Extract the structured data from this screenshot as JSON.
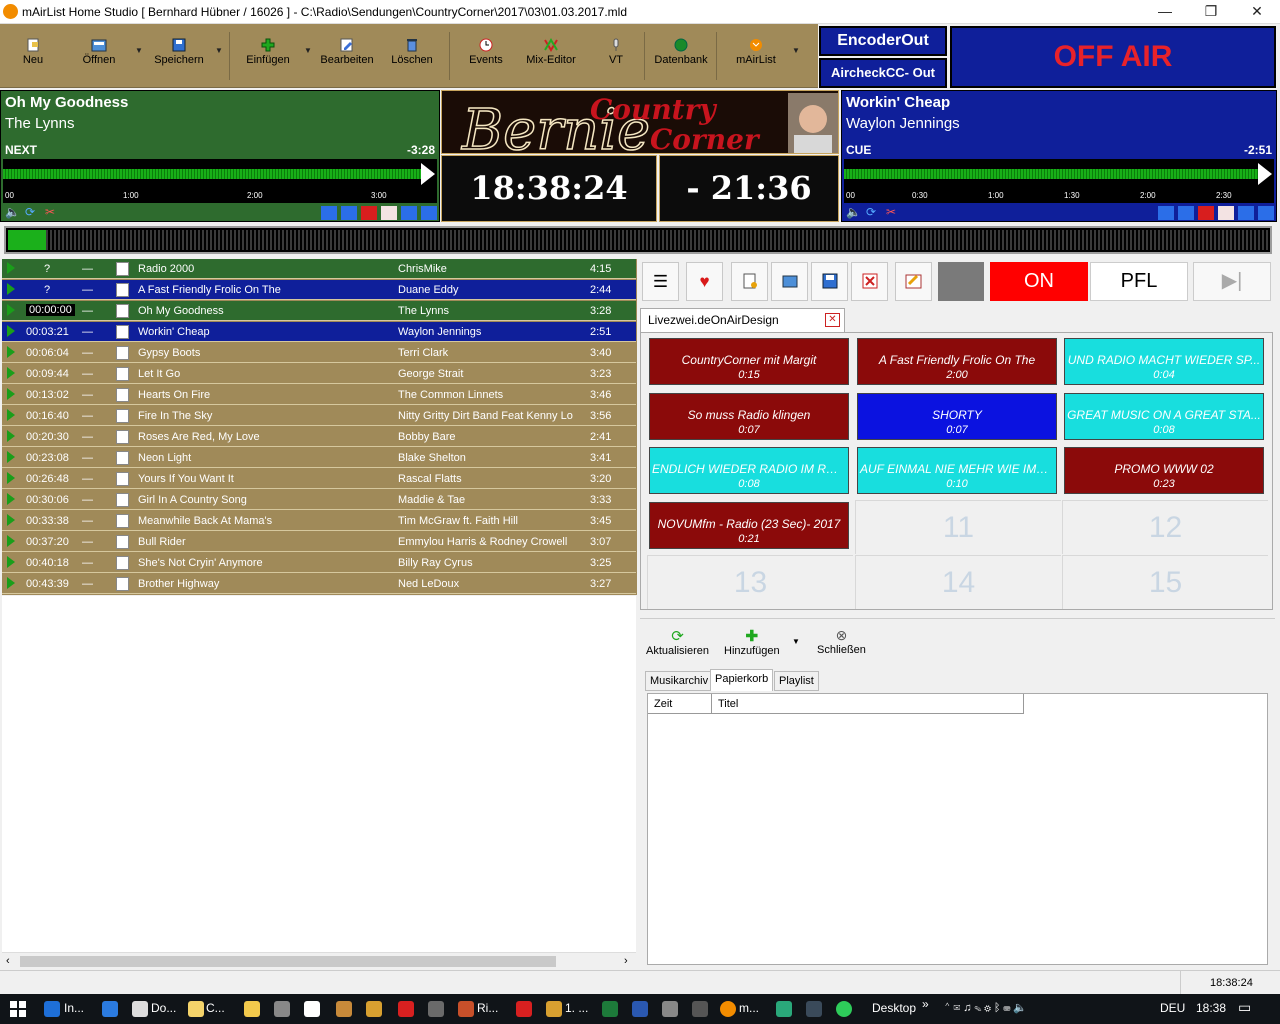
{
  "window": {
    "title": "mAirList Home Studio [ Bernhard Hübner / 16026 ] - C:\\Radio\\Sendungen\\CountryCorner\\2017\\03\\01.03.2017.mld",
    "min": "—",
    "max": "❐",
    "close": "✕"
  },
  "toolbar": {
    "buttons": [
      {
        "label": "Neu",
        "icon": "new-file-icon"
      },
      {
        "label": "Öffnen",
        "icon": "open-folder-icon"
      },
      {
        "label": "Speichern",
        "icon": "save-icon"
      },
      {
        "label": "Einfügen",
        "icon": "plus-icon"
      },
      {
        "label": "Bearbeiten",
        "icon": "edit-icon"
      },
      {
        "label": "Löschen",
        "icon": "delete-icon"
      },
      {
        "label": "Events",
        "icon": "clock-icon"
      },
      {
        "label": "Mix-Editor",
        "icon": "mixer-icon"
      },
      {
        "label": "VT",
        "icon": "microphone-icon"
      },
      {
        "label": "Datenbank",
        "icon": "database-icon"
      },
      {
        "label": "mAirList",
        "icon": "mairlist-logo-icon"
      }
    ]
  },
  "encoder": {
    "out": "EncoderOut",
    "aircheck": "AircheckCC- Out"
  },
  "air_status": "OFF AIR",
  "player_left": {
    "title": "Oh My Goodness",
    "artist": "The Lynns",
    "state": "NEXT",
    "remaining": "-3:28",
    "ruler": [
      "00",
      "1:00",
      "2:00",
      "3:00"
    ],
    "color": "#2e6b2e"
  },
  "player_right": {
    "title": "Workin' Cheap",
    "artist": "Waylon Jennings",
    "state": "CUE",
    "remaining": "-2:51",
    "ruler": [
      "00",
      "0:30",
      "1:00",
      "1:30",
      "2:00",
      "2:30"
    ],
    "color": "#0f1f9a"
  },
  "logo": {
    "line1": "Country",
    "line2": "Bernie",
    "line3": "Corner"
  },
  "clock": {
    "time": "18:38:24",
    "countdown": "- 21:36"
  },
  "playlist": {
    "rows": [
      {
        "time": "?",
        "title": "Radio 2000",
        "artist": "ChrisMike",
        "duration": "4:15",
        "bg": "#2e6b2e"
      },
      {
        "time": "?",
        "title": "A Fast Friendly Frolic On The",
        "artist": "Duane Eddy",
        "duration": "2:44",
        "bg": "#0f1f9a"
      },
      {
        "time": "00:00:00",
        "title": "Oh My Goodness",
        "artist": "The Lynns",
        "duration": "3:28",
        "bg": "#2e6b2e"
      },
      {
        "time": "00:03:21",
        "title": "Workin' Cheap",
        "artist": "Waylon Jennings",
        "duration": "2:51",
        "bg": "#0f1f9a"
      },
      {
        "time": "00:06:04",
        "title": "Gypsy Boots",
        "artist": "Terri Clark",
        "duration": "3:40",
        "bg": "#a08a59"
      },
      {
        "time": "00:09:44",
        "title": "Let It Go",
        "artist": "George Strait",
        "duration": "3:23",
        "bg": "#a08a59"
      },
      {
        "time": "00:13:02",
        "title": "Hearts On Fire",
        "artist": "The Common Linnets",
        "duration": "3:46",
        "bg": "#a08a59"
      },
      {
        "time": "00:16:40",
        "title": "Fire In The Sky",
        "artist": "Nitty Gritty Dirt Band Feat Kenny Lo",
        "duration": "3:56",
        "bg": "#a08a59"
      },
      {
        "time": "00:20:30",
        "title": "Roses Are Red, My Love",
        "artist": "Bobby Bare",
        "duration": "2:41",
        "bg": "#a08a59"
      },
      {
        "time": "00:23:08",
        "title": "Neon Light",
        "artist": "Blake Shelton",
        "duration": "3:41",
        "bg": "#a08a59"
      },
      {
        "time": "00:26:48",
        "title": "Yours If You Want It",
        "artist": "Rascal Flatts",
        "duration": "3:20",
        "bg": "#a08a59"
      },
      {
        "time": "00:30:06",
        "title": "Girl In A Country Song",
        "artist": "Maddie & Tae",
        "duration": "3:33",
        "bg": "#a08a59"
      },
      {
        "time": "00:33:38",
        "title": "Meanwhile Back At Mama's",
        "artist": "Tim McGraw  ft. Faith Hill",
        "duration": "3:45",
        "bg": "#a08a59"
      },
      {
        "time": "00:37:20",
        "title": "Bull Rider",
        "artist": "Emmylou Harris & Rodney Crowell",
        "duration": "3:07",
        "bg": "#a08a59"
      },
      {
        "time": "00:40:18",
        "title": "She's Not Cryin' Anymore",
        "artist": "Billy Ray Cyrus",
        "duration": "3:25",
        "bg": "#a08a59"
      },
      {
        "time": "00:43:39",
        "title": "Brother Highway",
        "artist": "Ned LeDoux",
        "duration": "3:27",
        "bg": "#a08a59"
      }
    ]
  },
  "cart_toolbar": {
    "on": "ON",
    "pfl": "PFL"
  },
  "cart_tab": "Livezwei.deOnAirDesign",
  "carts": [
    {
      "name": "CountryCorner mit Margit",
      "duration": "0:15",
      "bg": "#8b0a0a",
      "fg": "#ffffff"
    },
    {
      "name": "A Fast Friendly Frolic On The",
      "duration": "2:00",
      "bg": "#8b0a0a",
      "fg": "#ffffff"
    },
    {
      "name": "UND RADIO MACHT WIEDER SP...",
      "duration": "0:04",
      "bg": "#18dede",
      "fg": "#ffffff"
    },
    {
      "name": "So muss Radio klingen",
      "duration": "0:07",
      "bg": "#8b0a0a",
      "fg": "#ffffff"
    },
    {
      "name": "SHORTY",
      "duration": "0:07",
      "bg": "#0b12e0",
      "fg": "#ffffff"
    },
    {
      "name": "GREAT MUSIC ON A GREAT STA...",
      "duration": "0:08",
      "bg": "#18dede",
      "fg": "#ffffff"
    },
    {
      "name": "ENDLICH WIEDER RADIO IM RAD...",
      "duration": "0:08",
      "bg": "#18dede",
      "fg": "#ffffff"
    },
    {
      "name": "AUF EINMAL NIE MEHR WIE IMM...",
      "duration": "0:10",
      "bg": "#18dede",
      "fg": "#ffffff"
    },
    {
      "name": "PROMO WWW 02",
      "duration": "0:23",
      "bg": "#8b0a0a",
      "fg": "#ffffff"
    },
    {
      "name": "NOVUMfm - Radio (23 Sec)- 2017",
      "duration": "0:21",
      "bg": "#8b0a0a",
      "fg": "#ffffff"
    }
  ],
  "empty_slots": [
    "11",
    "12",
    "13",
    "14",
    "15"
  ],
  "archive": {
    "buttons": [
      "Aktualisieren",
      "Hinzufügen",
      "Schließen"
    ],
    "tabs": [
      "Musikarchiv",
      "Papierkorb",
      "Playlist"
    ],
    "active_tab": "Papierkorb",
    "columns": [
      "Zeit",
      "Titel"
    ]
  },
  "status": {
    "time": "18:38:24"
  },
  "taskbar": {
    "items": [
      "In...",
      "Do...",
      "C...",
      "Ri...",
      "1. ...",
      "m..."
    ],
    "desktop": "Desktop",
    "lang": "DEU",
    "time": "18:38"
  }
}
